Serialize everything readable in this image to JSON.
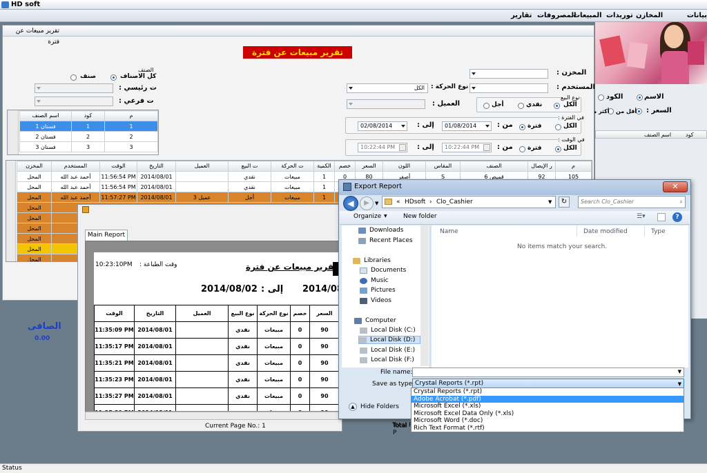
{
  "app": {
    "title": "HD soft"
  },
  "menu": {
    "main": "بيانات رئيسية",
    "stores": "المخازن",
    "supplies": "توريدات",
    "sales": "المبيعات",
    "expenses": "المصروفات",
    "reports": "تقارير"
  },
  "right_panel": {
    "name_label": "الاسم",
    "code_label": "الكود",
    "price_label": "السعر :",
    "less_than": "أقل من",
    "more_than": "أكثر من",
    "col_code": "كود",
    "col_item_name": "اسم الصنف"
  },
  "window": {
    "title": "تقرير مبيعات عن فترة",
    "banner": "تقرير مبيعات عن فترة"
  },
  "filters": {
    "store_label": "المخزن :",
    "user_label": "المستخدم :",
    "movement_type_label": "نوع الحركة :",
    "movement_type_value": "الكل",
    "customer_label": "العميل :",
    "sale_type_label": "نوع البيع",
    "all": "الكل",
    "cash": "نقدي",
    "credit": "أجل",
    "period_label": "في الفترة :",
    "from_label": "من :",
    "to_label": "إلى :",
    "period": "فترة",
    "date_from": "01/08/2014",
    "date_to": "02/08/2014",
    "time_label": "في الوقت :",
    "time_from": "10:22:44 PM",
    "time_to": "10:22:44 PM"
  },
  "category": {
    "group_label": "الصنف",
    "all_items": "كل الاصناف",
    "item": "صنف",
    "main_cat": "ت رئيسي :",
    "sub_cat": "ت فرعي :",
    "columns": [
      "م",
      "كود",
      "اسم الصنف"
    ],
    "rows": [
      [
        "1",
        "1",
        "فستان 1"
      ],
      [
        "2",
        "2",
        "فستان 2"
      ],
      [
        "3",
        "3",
        "فستان 3"
      ]
    ]
  },
  "sales_grid": {
    "columns": [
      "م",
      "ر الإيصال",
      "الصنف",
      "المقاس",
      "اللون",
      "السعر",
      "خصم",
      "الكمية",
      "ت الحركة",
      "ت البيع",
      "العميل",
      "التاريخ",
      "الوقت",
      "المستخدم",
      "المخزن"
    ],
    "rows": [
      [
        "105",
        "92",
        "قميص 6",
        "S",
        "أصفر",
        "80",
        "0",
        "1",
        "مبيعات",
        "نقدي",
        "",
        "2014/08/01",
        "11:56:54 PM",
        "أحمد عبد الله",
        "المحل"
      ],
      [
        "",
        "",
        "",
        "",
        "",
        "",
        "",
        "1",
        "مبيعات",
        "نقدي",
        "",
        "2014/08/01",
        "11:56:54 PM",
        "أحمد عبد الله",
        "المحل"
      ],
      [
        "",
        "",
        "",
        "",
        "",
        "",
        "",
        "1",
        "مبيعات",
        "أجل",
        "عميل 3",
        "2014/08/01",
        "11:57:27 PM",
        "أحمد عبد الله",
        "المحل"
      ]
    ],
    "extra_stores": [
      "المحل",
      "المحل",
      "المحل",
      "المحل",
      "المحل",
      "المحل"
    ]
  },
  "summary": {
    "net_label": "الصافى",
    "net_value": "0.00"
  },
  "crystal": {
    "tab": "Main Report",
    "print_time_label": "وقت الطباعة :",
    "print_time": "10:23:10PM",
    "title": "تقرير مبيعات عن فترة",
    "to_label": "إلى :",
    "date_to": "2014/08/02",
    "date_from": "2014/08",
    "current_page": "Current Page No.: 1",
    "total_page": "Total P",
    "columns": [
      "الوقت",
      "التاريخ",
      "العميل",
      "نوع البيع",
      "نوع الحركة",
      "خصم",
      "السعر"
    ],
    "rows": [
      [
        "11:35:09 PM",
        "2014/08/01",
        "",
        "نقدي",
        "مبيعات",
        "0",
        "90"
      ],
      [
        "11:35:17 PM",
        "2014/08/01",
        "",
        "نقدي",
        "مبيعات",
        "0",
        "90"
      ],
      [
        "11:35:21 PM",
        "2014/08/01",
        "",
        "نقدي",
        "مبيعات",
        "0",
        "90"
      ],
      [
        "11:35:23 PM",
        "2014/08/01",
        "",
        "نقدي",
        "مبيعات",
        "0",
        "90"
      ],
      [
        "11:35:27 PM",
        "2014/08/01",
        "",
        "نقدي",
        "مبيعات",
        "0",
        "90"
      ],
      [
        "11:35:29 PM",
        "2014/08/01",
        "",
        "نقدي",
        "مبيعات",
        "0",
        "90"
      ]
    ]
  },
  "export": {
    "title": "Export Report",
    "path_root": "«",
    "path_1": "HDsoft",
    "path_2": "Clo_Cashier",
    "search_placeholder": "Search Clo_Cashier",
    "organize": "Organize",
    "new_folder": "New folder",
    "nav": [
      "Downloads",
      "Recent Places",
      "Libraries",
      "Documents",
      "Music",
      "Pictures",
      "Videos",
      "Computer",
      "Local Disk (C:)",
      "Local Disk (D:)",
      "Local Disk (E:)",
      "Local Disk (F:)"
    ],
    "col_name": "Name",
    "col_date": "Date modified",
    "col_type": "Type",
    "empty": "No items match your search.",
    "file_name_label": "File name:",
    "file_name": "",
    "save_type_label": "Save as type:",
    "save_type": "Crystal Reports (*.rpt)",
    "hide_folders": "Hide Folders",
    "types": [
      "Crystal Reports (*.rpt)",
      "Adobe Acrobat (*.pdf)",
      "Microsoft Excel (*.xls)",
      "Microsoft Excel Data Only (*.xls)",
      "Microsoft Word (*.doc)",
      "Rich Text Format (*.rtf)"
    ]
  },
  "status": {
    "text": "Status"
  }
}
